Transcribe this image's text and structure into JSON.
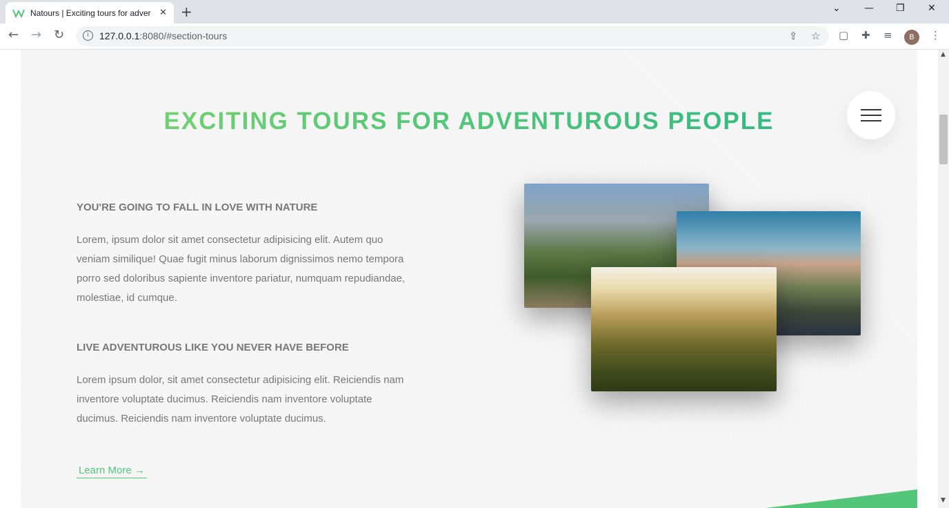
{
  "browser": {
    "tab_title": "Natours | Exciting tours for adver",
    "new_tab_symbol": "+",
    "close_symbol": "✕",
    "window_controls": [
      "⌄",
      "—",
      "❐",
      "✕"
    ],
    "url_host": "127.0.0.1",
    "url_rest": ":8080/#section-tours",
    "profile_initial": "B"
  },
  "page": {
    "heading": "EXCITING TOURS FOR ADVENTUROUS PEOPLE",
    "features": [
      {
        "title": "YOU'RE GOING TO FALL IN LOVE WITH NATURE",
        "text": "Lorem, ipsum dolor sit amet consectetur adipisicing elit. Autem quo veniam similique! Quae fugit minus laborum dignissimos nemo tempora porro sed doloribus sapiente inventore pariatur, numquam repudiandae, molestiae, id cumque."
      },
      {
        "title": "LIVE ADVENTUROUS LIKE YOU NEVER HAVE BEFORE",
        "text": "Lorem ipsum dolor, sit amet consectetur adipisicing elit. Reiciendis nam inventore voluptate ducimus. Reiciendis nam inventore voluptate ducimus. Reiciendis nam inventore voluptate ducimus."
      }
    ],
    "learn_more": "Learn More →",
    "accent_color": "#55c57a"
  }
}
